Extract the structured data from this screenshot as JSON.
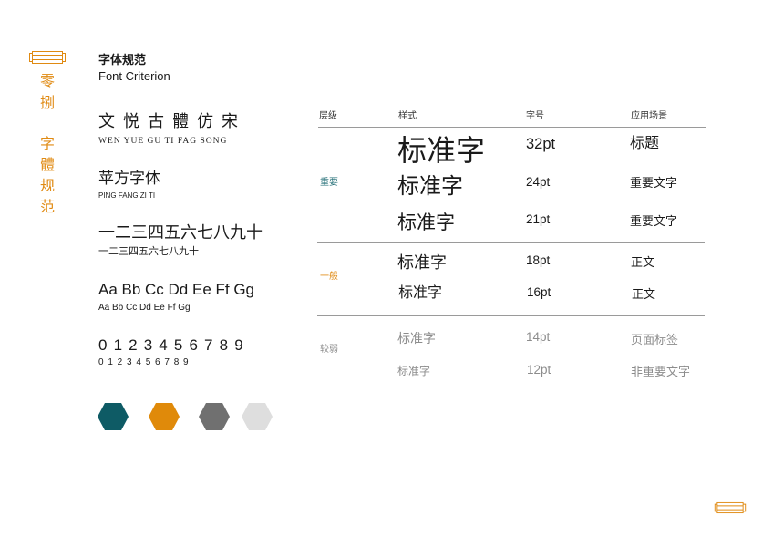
{
  "header": {
    "title_cn": "字体规范",
    "title_en": "Font Criterion"
  },
  "side": {
    "number": "零捌",
    "title": "字體规范"
  },
  "colors": {
    "accent_orange": "#e08a12",
    "teal": "#1f6c74",
    "muted": "#8c8c8c",
    "text": "#1a1a1a"
  },
  "typefaces": [
    {
      "name": "文悦古體仿宋",
      "pinyin": "WEN YUE GU TI FAG SONG"
    },
    {
      "name": "苹方字体",
      "pinyin": "PING FANG ZI TI"
    }
  ],
  "specimens": [
    {
      "large": "一二三四五六七八九十",
      "small": "一二三四五六七八九十"
    },
    {
      "large": "Aa Bb Cc Dd Ee Ff Gg",
      "small": "Aa Bb Cc Dd Ee Ff Gg"
    },
    {
      "large": "0 1 2 3 4 5 6 7 8 9",
      "small": "0 1 2 3 4 5 6 7 8 9"
    }
  ],
  "swatches": [
    "#0e5b65",
    "#e08a0a",
    "#707070",
    "#dedede"
  ],
  "table": {
    "headers": [
      "层级",
      "样式",
      "字号",
      "应用场景"
    ],
    "groups": [
      {
        "label": "重要",
        "color": "#1f6c74",
        "rows": [
          {
            "sample": "标准字",
            "size": "32pt",
            "usage": "标题"
          },
          {
            "sample": "标准字",
            "size": "24pt",
            "usage": "重要文字"
          },
          {
            "sample": "标准字",
            "size": "21pt",
            "usage": "重要文字"
          }
        ]
      },
      {
        "label": "一般",
        "color": "#e08a12",
        "rows": [
          {
            "sample": "标准字",
            "size": "18pt",
            "usage": "正文"
          },
          {
            "sample": "标准字",
            "size": "16pt",
            "usage": "正文"
          }
        ]
      },
      {
        "label": "较弱",
        "color": "#8c8c8c",
        "rows": [
          {
            "sample": "标准字",
            "size": "14pt",
            "usage": "页面标签"
          },
          {
            "sample": "标准字",
            "size": "12pt",
            "usage": "非重要文字"
          }
        ]
      }
    ]
  }
}
